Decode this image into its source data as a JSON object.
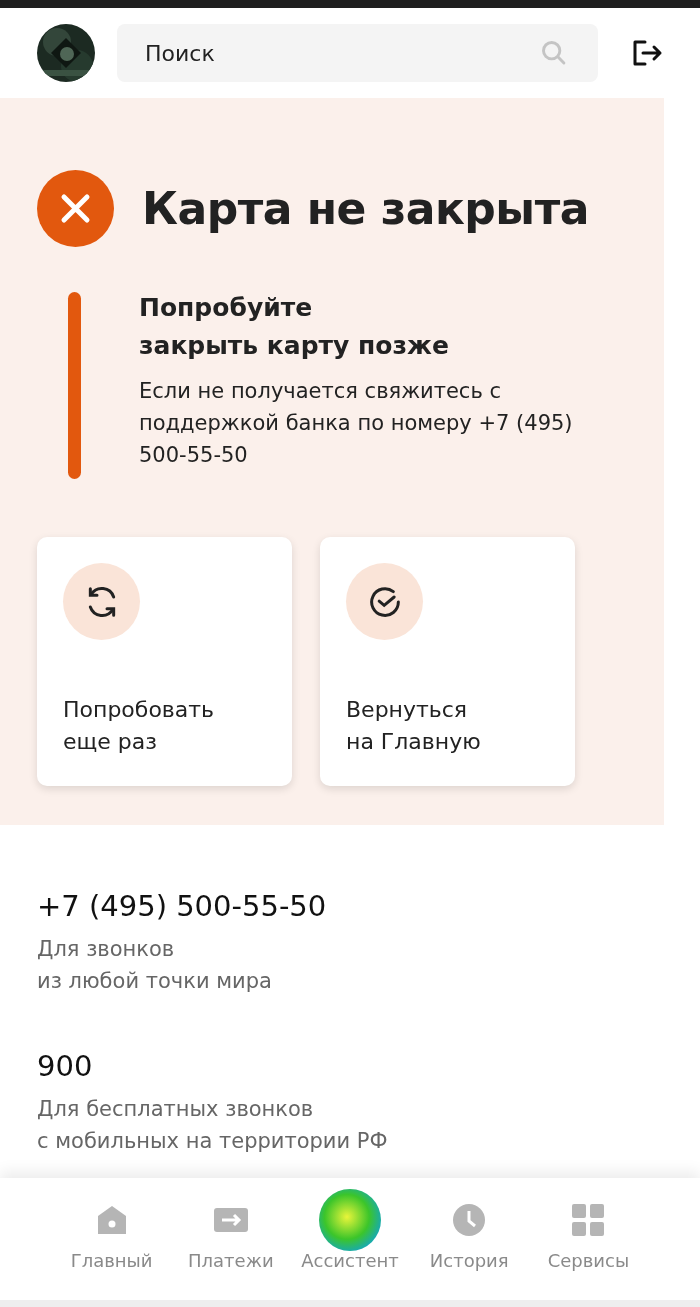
{
  "header": {
    "search": {
      "placeholder": "Поиск"
    }
  },
  "status": {
    "title": "Карта не закрыта",
    "heading_lines": [
      "Попробуйте",
      "закрыть карту позже"
    ],
    "message": "Если не получается свяжитесь с поддержкой банка по номеру +7 (495) 500-55-50"
  },
  "actions": [
    {
      "kind": "retry",
      "lines": [
        "Попробовать",
        "еще раз"
      ]
    },
    {
      "kind": "home",
      "lines": [
        "Вернуться",
        "на Главную"
      ]
    }
  ],
  "contacts": [
    {
      "number": "+7 (495) 500-55-50",
      "note_lines": [
        "Для звонков",
        "из любой точки мира"
      ]
    },
    {
      "number": "900",
      "note_lines": [
        "Для бесплатных звонков",
        "с мобильных на территории РФ"
      ]
    }
  ],
  "nav": [
    {
      "kind": "home",
      "label": "Главный"
    },
    {
      "kind": "payments",
      "label": "Платежи"
    },
    {
      "kind": "assistant",
      "label": "Ассистент"
    },
    {
      "kind": "history",
      "label": "История"
    },
    {
      "kind": "services",
      "label": "Сервисы"
    }
  ]
}
